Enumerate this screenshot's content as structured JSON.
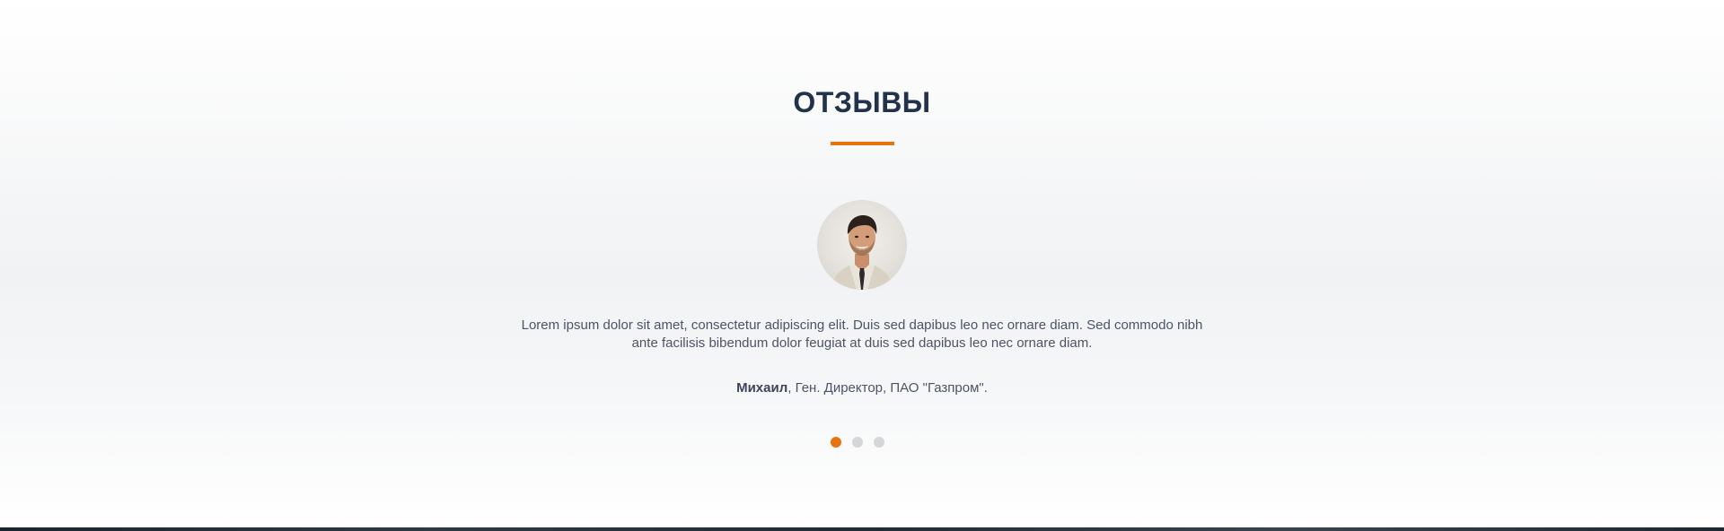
{
  "section": {
    "title": "ОТЗЫВЫ",
    "accent_color": "#e8740f",
    "title_color": "#22324a"
  },
  "testimonial": {
    "avatar_icon": "person-photo",
    "quote": "Lorem ipsum dolor sit amet, consectetur adipiscing elit. Duis sed dapibus leo nec ornare diam. Sed commodo nibh ante facilisis bibendum dolor feugiat at duis sed dapibus leo nec ornare diam.",
    "author_name": "Михаил",
    "author_role": ", Ген. Директор, ПАО \"Газпром\"."
  },
  "pager": {
    "count": 3,
    "active_index": 0
  }
}
